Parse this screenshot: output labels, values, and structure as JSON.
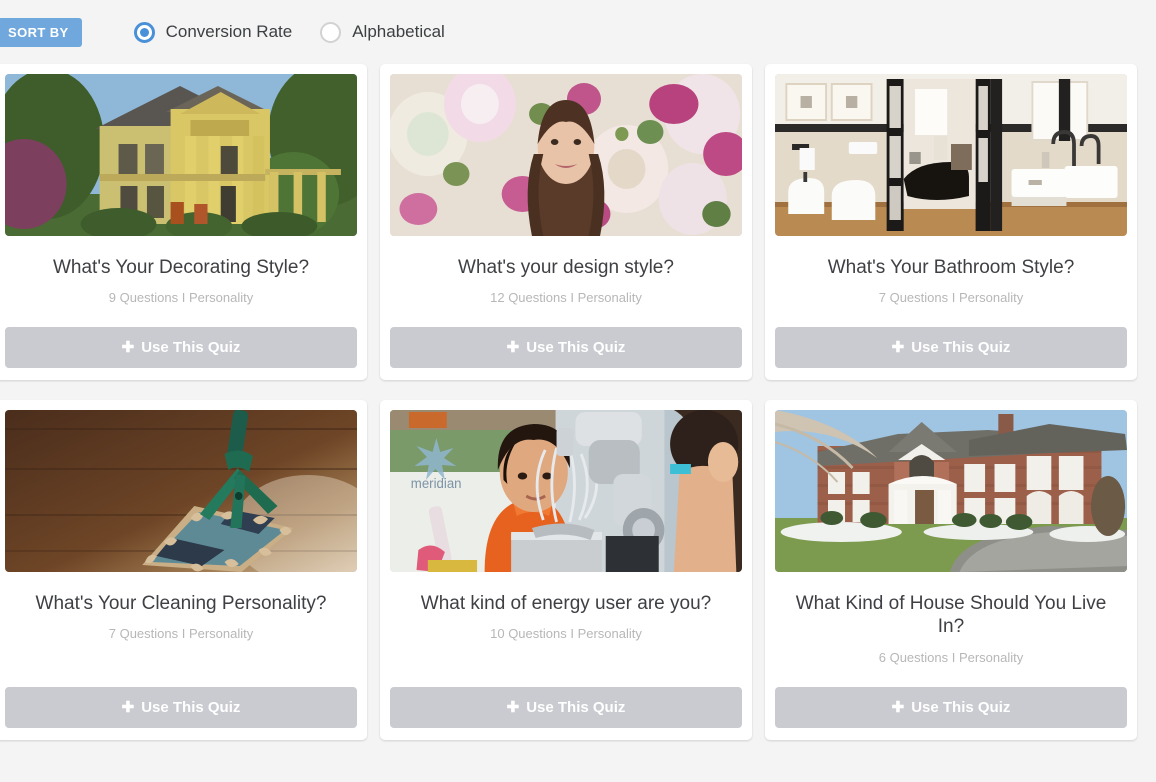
{
  "sort": {
    "badge_label": "SORT BY",
    "accent_color": "#70a8dd",
    "options": [
      {
        "label": "Conversion Rate",
        "selected": true
      },
      {
        "label": "Alphabetical",
        "selected": false
      }
    ]
  },
  "cards": [
    {
      "title": "What's Your Decorating Style?",
      "meta": "9 Questions I Personality",
      "button_label": "Use This Quiz",
      "image": "victorian-house-photo"
    },
    {
      "title": "What's your design style?",
      "meta": "12 Questions I Personality",
      "button_label": "Use This Quiz",
      "image": "woman-floral-backdrop-photo"
    },
    {
      "title": "What's Your Bathroom Style?",
      "meta": "7 Questions I Personality",
      "button_label": "Use This Quiz",
      "image": "modern-bathroom-photo"
    },
    {
      "title": "What's Your Cleaning Personality?",
      "meta": "7 Questions I Personality",
      "button_label": "Use This Quiz",
      "image": "dust-mop-hardwood-photo"
    },
    {
      "title": "What kind of energy user are you?",
      "meta": "10 Questions I Personality",
      "button_label": "Use This Quiz",
      "image": "boy-baking-mixer-photo"
    },
    {
      "title": "What Kind of House Should You Live In?",
      "meta": "6 Questions I Personality",
      "button_label": "Use This Quiz",
      "image": "brick-colonial-house-photo"
    }
  ]
}
